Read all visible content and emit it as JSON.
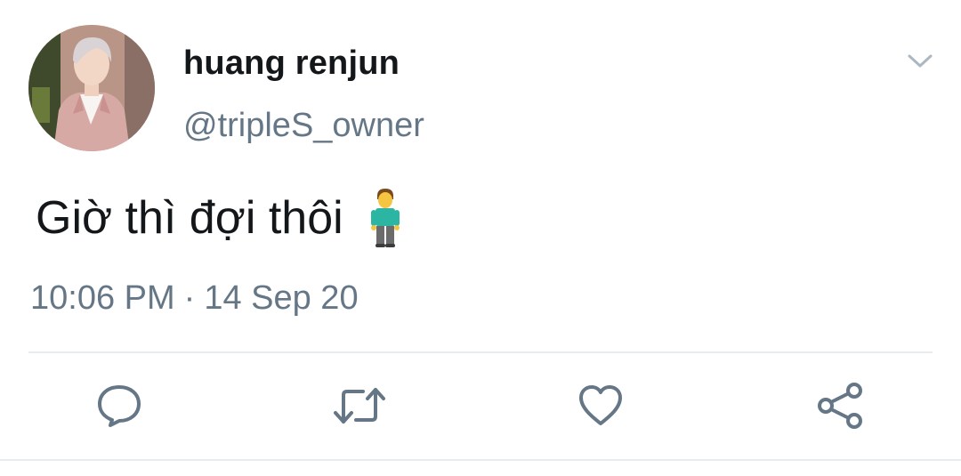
{
  "tweet": {
    "author": {
      "display_name": "huang renjun",
      "handle": "@tripleS_owner",
      "avatar": "profile-photo"
    },
    "text": "Giờ thì đợi thôi",
    "emoji": "man-standing-emoji",
    "time": "10:06 PM",
    "separator": "·",
    "date": "14 Sep 20"
  },
  "actions": [
    {
      "icon": "reply-icon"
    },
    {
      "icon": "retweet-icon"
    },
    {
      "icon": "like-icon"
    },
    {
      "icon": "share-icon"
    }
  ],
  "colors": {
    "text_primary": "#14171a",
    "text_secondary": "#657786",
    "icon": "#657786",
    "divider": "#e6ecf0"
  }
}
